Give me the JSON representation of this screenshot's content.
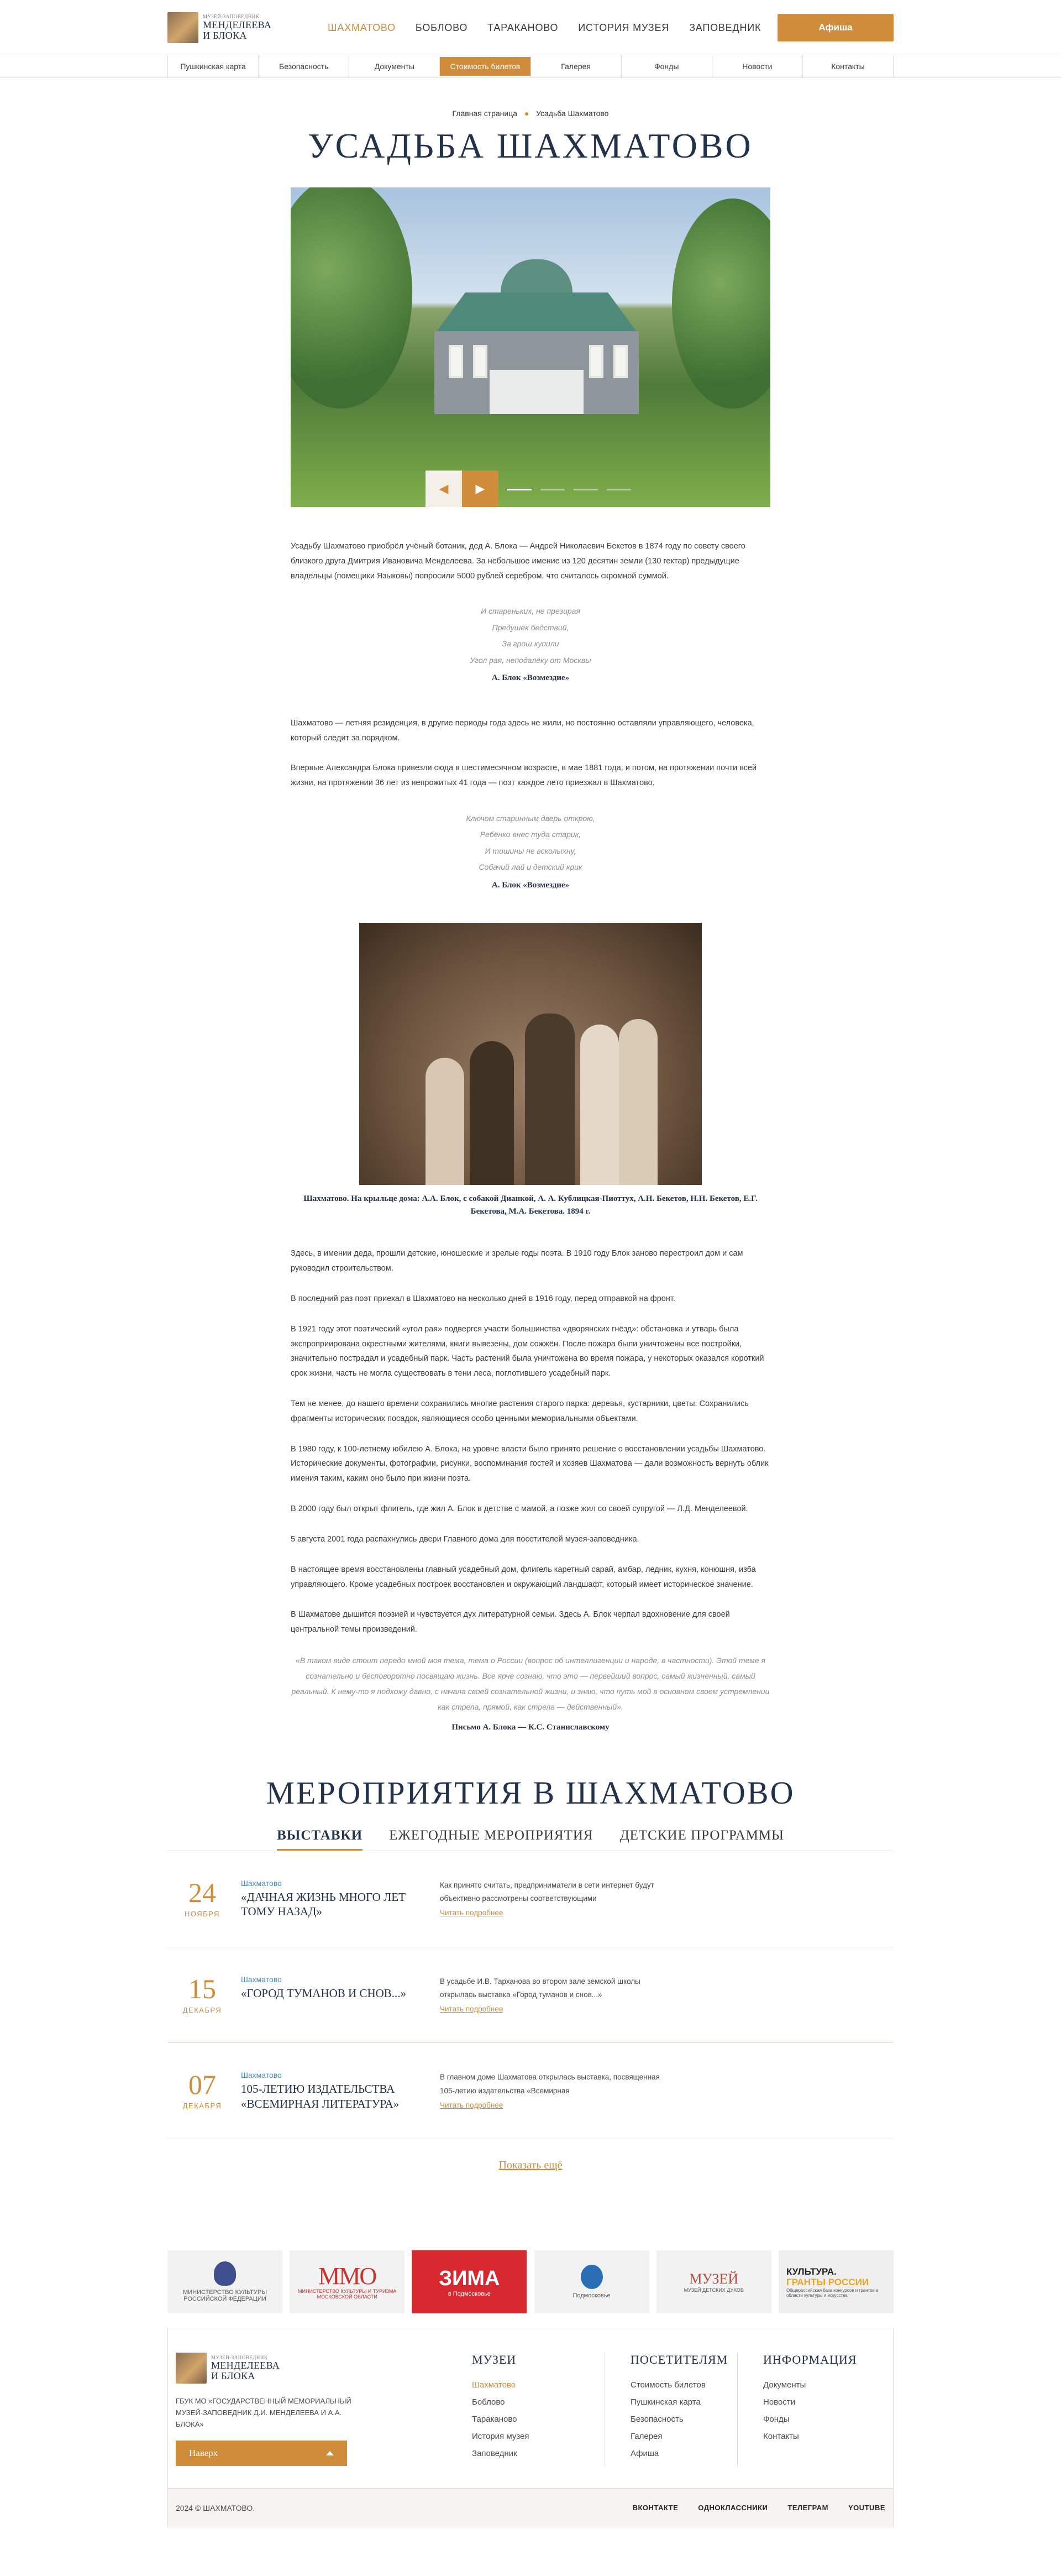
{
  "header": {
    "logo_small": "МУЗЕЙ-ЗАПОВЕДНИК",
    "logo_line1": "МЕНДЕЛЕЕВА",
    "logo_line2": "И БЛОКА",
    "nav": [
      "ШАХМАТОВО",
      "БОБЛОВО",
      "ТАРАКАНОВО",
      "ИСТОРИЯ МУЗЕЯ",
      "ЗАПОВЕДНИК"
    ],
    "nav_active": 0,
    "afisha_label": "Афиша"
  },
  "subnav": {
    "items": [
      "Пушкинская карта",
      "Безопасность",
      "Документы",
      "Стоимость билетов",
      "Галерея",
      "Фонды",
      "Новости",
      "Контакты"
    ],
    "active": 3
  },
  "breadcrumb": [
    "Главная страница",
    "Усадьба Шахматово"
  ],
  "page_title": "УСАДЬБА ШАХМАТОВО",
  "slider": {
    "prev_icon": "arrow-left-icon",
    "next_icon": "arrow-right-icon",
    "slide_count": 4,
    "active_slide": 0
  },
  "article": {
    "p1": "Усадьбу Шахматово приобрёл учёный ботаник, дед А. Блока — Андрей Николаевич Бекетов в 1874 году по совету своего близкого друга Дмитрия Ивановича Менделеева. За небольшое имение из 120 десятин земли (130 гектар) предыдущие владельцы (помещики Языковы) попросили 5000 рублей серебром, что считалось скромной суммой.",
    "verse1": [
      "И стареньких, не презирая",
      "Предушек бедствий,",
      "За грош купили",
      "Угол рая, неподалёку от Москвы"
    ],
    "verse1_src": "А. Блок «Возмездие»",
    "p2": "Шахматово — летняя резиденция, в другие периоды года здесь не жили, но постоянно оставляли управляющего, человека, который следит за порядком.",
    "p3": "Впервые Александра Блока привезли сюда в шестимесячном возрасте, в мае 1881 года, и потом, на протяжении почти всей жизни, на протяжении 36 лет из непрожитых 41 года — поэт каждое лето приезжал в Шахматово.",
    "verse2": [
      "Ключом старинным дверь открою,",
      "Ребёнко внес туда старик,",
      "И тишины не всколыхну,",
      "Собачий лай и детский крик"
    ],
    "verse2_src": "А. Блок «Возмездие»",
    "photo_caption": "Шахматово. На крыльце дома: А.А. Блок, с собакой Дианкой, А. А. Кублицкая-Пиоттух, А.Н. Бекетов, Н.Н. Бекетов, Е.Г. Бекетова, М.А. Бекетова. 1894 г.",
    "p4": "Здесь, в имении деда, прошли детские, юношеские и зрелые годы поэта. В 1910 году Блок заново перестроил дом и сам руководил строительством.",
    "p5": "В последний раз поэт приехал в Шахматово на несколько дней в 1916 году, перед отправкой на фронт.",
    "p6": "В 1921 году этот поэтический «угол рая» подвергся участи большинства «дворянских гнёзд»: обстановка и утварь была экспроприирована окрестными жителями, книги вывезены, дом сожжён. После пожара были уничтожены все постройки, значительно пострадал и усадебный парк. Часть растений была уничтожена во время пожара, у некоторых оказался короткий срок жизни, часть не могла существовать в тени леса, поглотившего усадебный парк.",
    "p7": "Тем не менее, до нашего времени сохранились многие растения старого парка: деревья, кустарники, цветы. Сохранились фрагменты исторических посадок, являющиеся особо ценными мемориальными объектами.",
    "p8": "В 1980 году, к 100-летнему юбилею А. Блока, на уровне власти было принято решение о восстановлении усадьбы Шахматово. Исторические документы, фотографии, рисунки, воспоминания гостей и хозяев Шахматова — дали возможность вернуть облик имения таким, каким оно было при жизни поэта.",
    "p9": "В 2000 году был открыт флигель, где жил А. Блок в детстве с мамой, а позже жил со своей супругой — Л.Д. Менделеевой.",
    "p10": "5 августа 2001 года распахнулись двери Главного дома для посетителей музея-заповедника.",
    "p11": "В настоящее время восстановлены главный усадебный дом, флигель каретный сарай, амбар, ледник, кухня, конюшня, изба управляющего. Кроме усадебных построек восстановлен и окружающий ландшафт, который имеет историческое значение.",
    "p12": "В Шахматове дышится поэзией и чувствуется дух литературной семьи. Здесь А. Блок черпал вдохновение для своей центральной темы произведений.",
    "quote": "«В таком виде стоит передо мной моя тема, тема о России (вопрос об интеллигенции и народе, в частности). Этой теме я сознательно и бесповоротно посвящаю жизнь. Все ярче сознаю, что это — первейший вопрос, самый жизненный, самый реальный. К нему-то я подхожу давно, с начала своей сознательной жизни, и знаю, что путь мой в основном своем устремлении как стрела, прямой, как стрела — действенный».",
    "quote_src": "Письмо А. Блока — К.С. Станиславскому"
  },
  "events": {
    "title": "МЕРОПРИЯТИЯ В ШАХМАТОВО",
    "tabs": [
      "ВЫСТАВКИ",
      "ЕЖЕГОДНЫЕ МЕРОПРИЯТИЯ",
      "ДЕТСКИЕ ПРОГРАММЫ"
    ],
    "active_tab": 0,
    "items": [
      {
        "day": "24",
        "month": "НОЯБРЯ",
        "place": "Шахматово",
        "title": "«ДАЧНАЯ ЖИЗНЬ МНОГО ЛЕТ ТОМУ НАЗАД»",
        "desc": "Как принято считать, предприниматели в сети интернет будут объективно рассмотрены соответствующими",
        "more": "Читать подробнее"
      },
      {
        "day": "15",
        "month": "ДЕКАБРЯ",
        "place": "Шахматово",
        "title": "«ГОРОД ТУМАНОВ И СНОВ...»",
        "desc": "В усадьбе И.В. Тарханова во втором зале земской школы открылась выставка «Город туманов и снов...»",
        "more": "Читать подробнее"
      },
      {
        "day": "07",
        "month": "ДЕКАБРЯ",
        "place": "Шахматово",
        "title": "105-ЛЕТИЮ ИЗДАТЕЛЬСТВА «ВСЕМИРНАЯ ЛИТЕРАТУРА»",
        "desc": "В главном доме Шахматова открылась выставка, посвященная 105-летию издательства «Всемирная",
        "more": "Читать подробнее"
      }
    ],
    "show_more": "Показать ещё"
  },
  "partners": [
    {
      "type": "emblem",
      "label": "МИНИСТЕРСТВО КУЛЬТУРЫ РОССИЙСКОЙ ФЕДЕРАЦИИ"
    },
    {
      "type": "mmo",
      "mark": "MMO",
      "label": "МИНИСТЕРСТВО КУЛЬТУРЫ И ТУРИЗМА МОСКОВСКОЙ ОБЛАСТИ"
    },
    {
      "type": "red",
      "mark": "ЗИМА",
      "label": "в Подмосковье"
    },
    {
      "type": "emblem",
      "label": "Подмосковье"
    },
    {
      "type": "text",
      "mark": "МУЗЕЙ",
      "label": "МУЗЕЙ ДЕТСКИХ ДУХОВ"
    },
    {
      "type": "kultura",
      "mark": "КУЛЬТУРА.",
      "accent": "ГРАНТЫ РОССИИ",
      "label": "Общероссийская база конкурсов и грантов в области культуры и искусства"
    }
  ],
  "footer": {
    "logo_small": "МУЗЕЙ-ЗАПОВЕДНИК",
    "logo_line1": "МЕНДЕЛЕЕВА",
    "logo_line2": "И БЛОКА",
    "address": "ГБУК МО «ГОСУДАРСТВЕННЫЙ МЕМОРИАЛЬНЫЙ МУЗЕЙ-ЗАПОВЕДНИК Д.И. МЕНДЕЛЕЕВА И А.А. БЛОКА»",
    "nav_button": "Наверх",
    "col1_title": "МУЗЕИ",
    "col1": [
      "Шахматово",
      "Боблово",
      "Тараканово",
      "История музея",
      "Заповедник"
    ],
    "col2_title": "ПОСЕТИТЕЛЯМ",
    "col2": [
      "Стоимость билетов",
      "Пушкинская карта",
      "Безопасность",
      "Галерея",
      "Афиша"
    ],
    "col3_title": "ИНФОРМАЦИЯ",
    "col3": [
      "Документы",
      "Новости",
      "Фонды",
      "Контакты"
    ],
    "copyright": "2024 © ШАХМАТОВО.",
    "socials": [
      "ВКОНТАКТЕ",
      "ОДНОКЛАССНИКИ",
      "ТЕЛЕГРАМ",
      "YOUTUBE"
    ]
  }
}
